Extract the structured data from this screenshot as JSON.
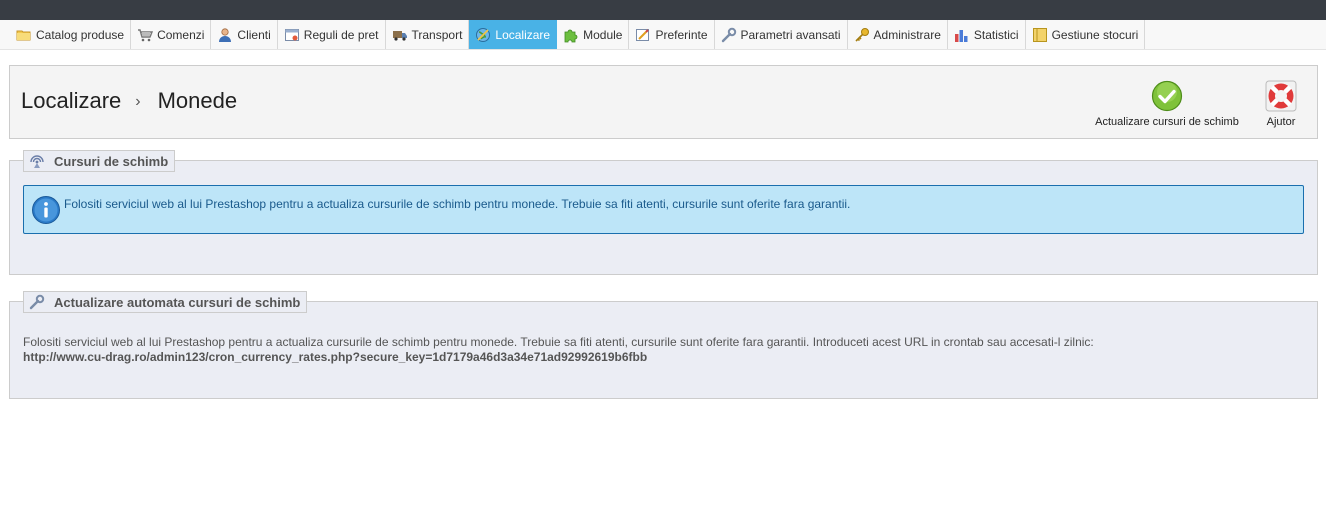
{
  "menu": {
    "items": [
      {
        "label": "Catalog produse",
        "icon": "folder-icon"
      },
      {
        "label": "Comenzi",
        "icon": "cart-icon"
      },
      {
        "label": "Clienti",
        "icon": "user-icon"
      },
      {
        "label": "Reguli de pret",
        "icon": "price-rules-icon"
      },
      {
        "label": "Transport",
        "icon": "truck-icon"
      },
      {
        "label": "Localizare",
        "icon": "globe-icon"
      },
      {
        "label": "Module",
        "icon": "puzzle-icon"
      },
      {
        "label": "Preferinte",
        "icon": "preferences-icon"
      },
      {
        "label": "Parametri avansati",
        "icon": "wrench-icon"
      },
      {
        "label": "Administrare",
        "icon": "key-icon"
      },
      {
        "label": "Statistici",
        "icon": "bar-chart-icon"
      },
      {
        "label": "Gestiune stocuri",
        "icon": "stock-icon"
      }
    ],
    "active_index": 5,
    "active_color": "#49b2e6"
  },
  "header": {
    "breadcrumb_parent": "Localizare",
    "breadcrumb_separator": "›",
    "breadcrumb_current": "Monede",
    "update_button_label": "Actualizare cursuri de schimb",
    "help_button_label": "Ajutor"
  },
  "exchange_rates": {
    "legend": "Cursuri de schimb",
    "info_text": "Folositi serviciul web al lui Prestashop pentru a actualiza cursurile de schimb pentru monede. Trebuie sa fiti atenti, cursurile sunt oferite fara garantii."
  },
  "auto_update": {
    "legend": "Actualizare automata cursuri de schimb",
    "text": "Folositi serviciul web al lui Prestashop pentru a actualiza cursurile de schimb pentru monede. Trebuie sa fiti atenti, cursurile sunt oferite fara garantii. Introduceti acest URL in crontab sau accesati-l zilnic:",
    "url": "http://www.cu-drag.ro/admin123/cron_currency_rates.php?secure_key=1d7179a46d3a34e71ad92992619b6fbb"
  }
}
